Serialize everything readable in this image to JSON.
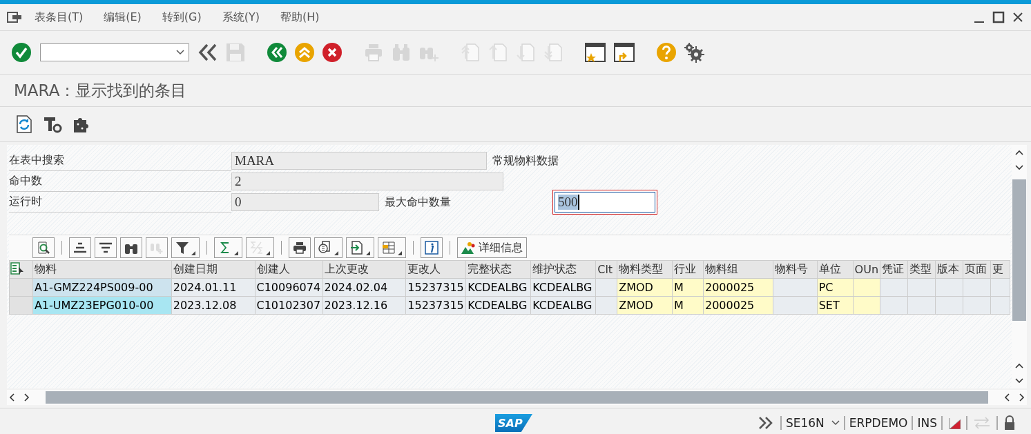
{
  "menu": [
    {
      "label": "表条目(T)"
    },
    {
      "label": "编辑(E)"
    },
    {
      "label": "转到(G)"
    },
    {
      "label": "系统(Y)"
    },
    {
      "label": "帮助(H)"
    }
  ],
  "toolbar": [
    {
      "kind": "enter",
      "disabled": false
    },
    {
      "kind": "command"
    },
    {
      "kind": "collapse",
      "disabled": false
    },
    {
      "kind": "save",
      "disabled": true
    },
    {
      "kind": "back",
      "disabled": false
    },
    {
      "kind": "exit",
      "disabled": false
    },
    {
      "kind": "cancel",
      "disabled": false
    },
    {
      "kind": "print",
      "disabled": true
    },
    {
      "kind": "find",
      "disabled": true
    },
    {
      "kind": "find-next",
      "disabled": true
    },
    {
      "kind": "first",
      "disabled": true
    },
    {
      "kind": "prev",
      "disabled": true
    },
    {
      "kind": "next",
      "disabled": true
    },
    {
      "kind": "last",
      "disabled": true
    },
    {
      "kind": "new-session",
      "disabled": false
    },
    {
      "kind": "shortcut",
      "disabled": false
    },
    {
      "kind": "help",
      "disabled": false
    },
    {
      "kind": "settings",
      "disabled": false
    }
  ],
  "title": "MARA：显示找到的条目",
  "app_toolbar": [
    {
      "kind": "refresh"
    },
    {
      "kind": "tools"
    },
    {
      "kind": "puzzle"
    }
  ],
  "form": [
    {
      "label": "在表中搜索",
      "value": "MARA",
      "description": "常规物料数据"
    },
    {
      "label": "命中数",
      "value": "2"
    },
    {
      "label": "运行时",
      "value": "0",
      "extra_label": "最大命中数量",
      "extra_value": "500"
    }
  ],
  "grid_toolbar": [
    {
      "kind": "details",
      "disabled": false
    },
    {
      "kind": "sep"
    },
    {
      "kind": "sort-up",
      "disabled": false
    },
    {
      "kind": "sort-down",
      "disabled": false
    },
    {
      "kind": "find",
      "disabled": false
    },
    {
      "kind": "find-next",
      "disabled": true
    },
    {
      "kind": "filter",
      "disabled": false,
      "menu": true
    },
    {
      "kind": "sep"
    },
    {
      "kind": "sum",
      "disabled": false,
      "menu": true
    },
    {
      "kind": "subtotal",
      "disabled": true,
      "menu": true
    },
    {
      "kind": "sep"
    },
    {
      "kind": "print",
      "disabled": false
    },
    {
      "kind": "views",
      "disabled": false,
      "menu": true
    },
    {
      "kind": "export",
      "disabled": false,
      "menu": true
    },
    {
      "kind": "layout",
      "disabled": false,
      "menu": true
    },
    {
      "kind": "sep"
    },
    {
      "kind": "info",
      "disabled": false
    },
    {
      "kind": "sep"
    },
    {
      "kind": "text",
      "label": "详细信息",
      "disabled": false
    }
  ],
  "table": {
    "columns": [
      {
        "label": "物料",
        "kind": "key"
      },
      {
        "label": "创建日期",
        "kind": "plain"
      },
      {
        "label": "创建人",
        "kind": "plain"
      },
      {
        "label": "上次更改",
        "kind": "plain"
      },
      {
        "label": "更改人",
        "kind": "plain"
      },
      {
        "label": "完整状态",
        "kind": "plain"
      },
      {
        "label": "维护状态",
        "kind": "plain"
      },
      {
        "label": "Clt",
        "kind": "plain"
      },
      {
        "label": "物料类型",
        "kind": "input"
      },
      {
        "label": "行业",
        "kind": "input"
      },
      {
        "label": "物料组",
        "kind": "input"
      },
      {
        "label": "物料号",
        "kind": "plain"
      },
      {
        "label": "单位",
        "kind": "input"
      },
      {
        "label": "OUn",
        "kind": "input"
      },
      {
        "label": "凭证",
        "kind": "plain"
      },
      {
        "label": "类型",
        "kind": "plain"
      },
      {
        "label": "版本",
        "kind": "plain"
      },
      {
        "label": "页面",
        "kind": "plain"
      },
      {
        "label": "更",
        "kind": "plain"
      }
    ],
    "rows": [
      {
        "focused": true,
        "cells": [
          "A1-GMZ224PS009-00",
          "2024.01.11",
          "C10096074",
          "2024.02.04",
          "15237315",
          "KCDEALBG",
          "KCDEALBG",
          null,
          "ZMOD",
          "M",
          "2000025",
          null,
          "PC"
        ]
      },
      {
        "focused": false,
        "cells": [
          "A1-UMZ23EPG010-00",
          "2023.12.08",
          "C10102307",
          "2023.12.16",
          "15237315",
          "KCDEALBG",
          "KCDEALBG",
          null,
          "ZMOD",
          "M",
          "2000025",
          null,
          "SET"
        ]
      }
    ]
  },
  "status_bar": {
    "logo": "SAP",
    "transaction": "SE16N",
    "system": "ERPDEMO",
    "mode": "INS"
  }
}
